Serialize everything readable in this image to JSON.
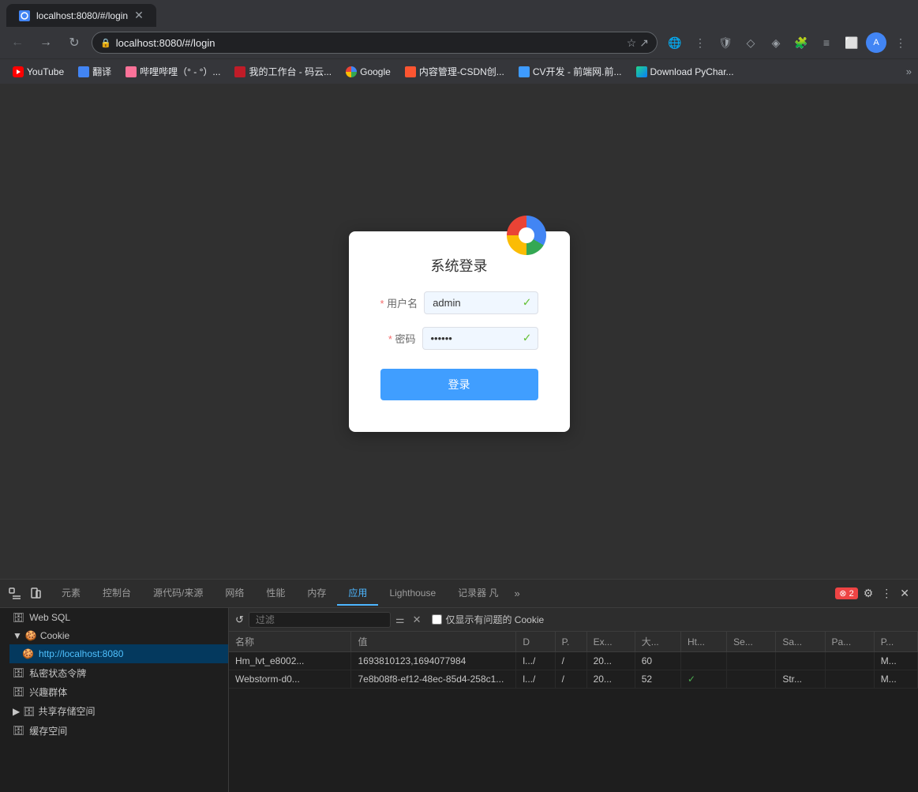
{
  "browser": {
    "tab": {
      "title": "localhost:8080/#/login",
      "favicon_color": "#4285f4"
    },
    "address": "localhost:8080/#/login",
    "address_full": "localhost:8080/#/login"
  },
  "bookmarks": [
    {
      "id": "youtube",
      "label": "YouTube",
      "color": "#ff0000"
    },
    {
      "id": "fanyi",
      "label": "翻译",
      "color": "#4285f4"
    },
    {
      "id": "bilibili",
      "label": "哔哩哔哩（° - °）...",
      "color": "#fb7299"
    },
    {
      "id": "work",
      "label": "我的工作台 - 码云...",
      "color": "#c01c28"
    },
    {
      "id": "google",
      "label": "Google",
      "color": "#4285f4"
    },
    {
      "id": "csdn",
      "label": "内容管理-CSDN创...",
      "color": "#fc5531"
    },
    {
      "id": "cv",
      "label": "CV开发 - 前端网.前...",
      "color": "#3e9bff"
    },
    {
      "id": "pycharm",
      "label": "Download PyChar...",
      "color": "#21d789"
    }
  ],
  "login": {
    "title": "系统登录",
    "username_label": "* 用户名",
    "password_label": "* 密码",
    "username_value": "admin",
    "password_placeholder": "••••••",
    "login_button": "登录",
    "required_mark": "*"
  },
  "devtools": {
    "tabs": [
      {
        "id": "elements",
        "label": "元素",
        "active": false
      },
      {
        "id": "console",
        "label": "控制台",
        "active": false
      },
      {
        "id": "sources",
        "label": "源代码/来源",
        "active": false
      },
      {
        "id": "network",
        "label": "网络",
        "active": false
      },
      {
        "id": "performance",
        "label": "性能",
        "active": false
      },
      {
        "id": "memory",
        "label": "内存",
        "active": false
      },
      {
        "id": "application",
        "label": "应用",
        "active": true
      },
      {
        "id": "lighthouse",
        "label": "Lighthouse",
        "active": false
      },
      {
        "id": "recorder",
        "label": "记录器 凡",
        "active": false
      }
    ],
    "badge_count": "2",
    "sidebar": {
      "items": [
        {
          "id": "websql",
          "label": "Web SQL",
          "icon": "🗄",
          "level": 0
        },
        {
          "id": "cookie-parent",
          "label": "Cookie",
          "icon": "🍪",
          "level": 0,
          "expanded": true
        },
        {
          "id": "cookie-local",
          "label": "http://localhost:8080",
          "icon": "🍪",
          "level": 1,
          "selected": true
        },
        {
          "id": "secret-token",
          "label": "私密状态令牌",
          "icon": "🗄",
          "level": 0
        },
        {
          "id": "interest-group",
          "label": "兴趣群体",
          "icon": "🗄",
          "level": 0
        },
        {
          "id": "shared-storage",
          "label": "共享存储空间",
          "icon": "🗄",
          "level": 0,
          "has_arrow": true
        },
        {
          "id": "cache-storage",
          "label": "缓存空间",
          "icon": "🗄",
          "level": 0
        }
      ]
    },
    "cookie_filter_placeholder": "过滤",
    "show_issues_only": "仅显示有问题的 Cookie",
    "table": {
      "columns": [
        "名称",
        "值",
        "D",
        "P.",
        "Ex...",
        "大...",
        "Ht...",
        "Se...",
        "Sa...",
        "Pa...",
        "P..."
      ],
      "rows": [
        {
          "name": "Hm_lvt_e8002...",
          "value": "1693810123,1694077984",
          "d": "l.../",
          "p": "/",
          "ex": "20...",
          "size": "60",
          "ht": "",
          "se": "",
          "sa": "",
          "pa": "",
          "p2": "M..."
        },
        {
          "name": "Webstorm-d0...",
          "value": "7e8b08f8-ef12-48ec-85d4-258c1...",
          "d": "l.../",
          "p": "/",
          "ex": "20...",
          "size": "52",
          "ht": "✓",
          "se": "",
          "sa": "Str...",
          "pa": "",
          "p2": "M..."
        }
      ]
    }
  }
}
